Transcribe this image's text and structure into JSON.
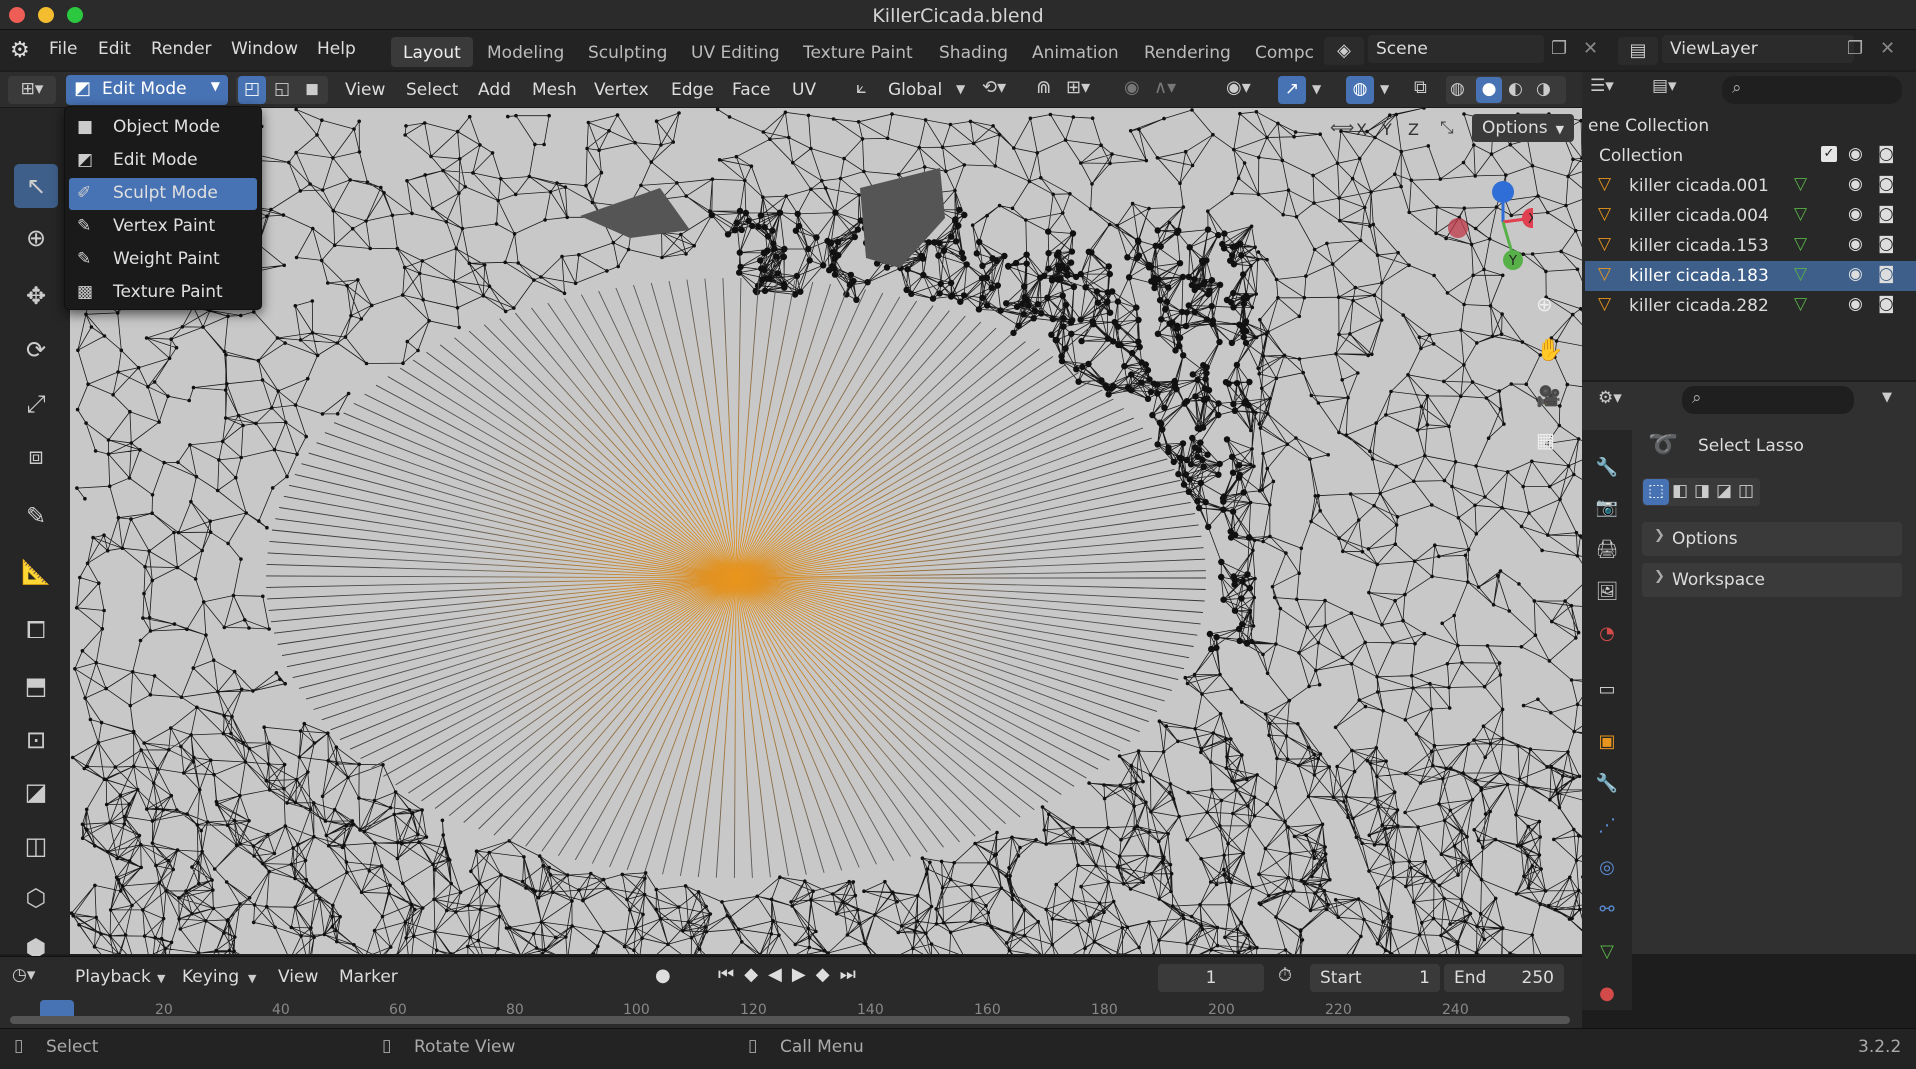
{
  "window": {
    "title": "KillerCicada.blend"
  },
  "menubar": {
    "items": [
      "File",
      "Edit",
      "Render",
      "Window",
      "Help"
    ]
  },
  "workspaces": {
    "tabs": [
      "Layout",
      "Modeling",
      "Sculpting",
      "UV Editing",
      "Texture Paint",
      "Shading",
      "Animation",
      "Rendering",
      "Compc"
    ],
    "active": "Layout"
  },
  "scene": {
    "label": "Scene"
  },
  "view_layer": {
    "label": "ViewLayer"
  },
  "header": {
    "mode": "Edit Mode",
    "menus": [
      "View",
      "Select",
      "Add",
      "Mesh",
      "Vertex",
      "Edge",
      "Face",
      "UV"
    ],
    "orientation": "Global",
    "options": "Options",
    "axes": [
      "X",
      "Y",
      "Z"
    ]
  },
  "mode_dropdown": {
    "items": [
      "Object Mode",
      "Edit Mode",
      "Sculpt Mode",
      "Vertex Paint",
      "Weight Paint",
      "Texture Paint"
    ],
    "highlighted": "Sculpt Mode"
  },
  "outliner": {
    "scene_collection": "ene Collection",
    "collection": "Collection",
    "objects": [
      "killer cicada.001",
      "killer cicada.004",
      "killer cicada.153",
      "killer cicada.183",
      "killer cicada.282"
    ],
    "selected": "killer cicada.183"
  },
  "properties": {
    "tool_name": "Select Lasso",
    "panels": [
      "Options",
      "Workspace"
    ]
  },
  "timeline": {
    "menus": [
      "Playback",
      "Keying",
      "View",
      "Marker"
    ],
    "current_frame": "1",
    "start_label": "Start",
    "start": "1",
    "end_label": "End",
    "end": "250",
    "ruler": [
      "20",
      "40",
      "60",
      "80",
      "100",
      "120",
      "140",
      "160",
      "180",
      "200",
      "220",
      "240"
    ]
  },
  "statusbar": {
    "select": "Select",
    "rotate": "Rotate View",
    "call_menu": "Call Menu",
    "version": "3.2.2"
  },
  "colors": {
    "accent": "#4772b3",
    "selected_vertex": "#e8951e",
    "outliner_selected": "#3e5f8a"
  }
}
